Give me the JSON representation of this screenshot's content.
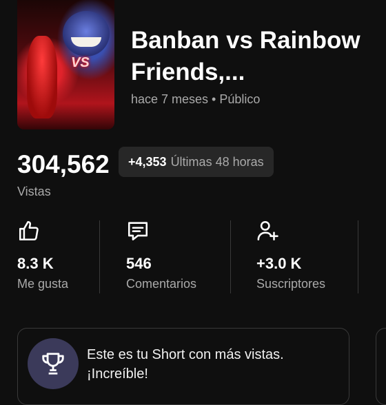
{
  "video": {
    "thumbnail": {
      "overlay_text": "VS"
    },
    "title": "Banban vs Rainbow Friends,...",
    "meta": "hace 7 meses • Público"
  },
  "views": {
    "count": "304,562",
    "label": "Vistas",
    "delta": {
      "value": "+4,353",
      "period": "Últimas 48 horas"
    }
  },
  "stats": [
    {
      "icon": "thumbs-up-icon",
      "value": "8.3 K",
      "label": "Me gusta"
    },
    {
      "icon": "comment-icon",
      "value": "546",
      "label": "Comentarios"
    },
    {
      "icon": "add-subscriber-icon",
      "value": "+3.0 K",
      "label": "Suscriptores"
    }
  ],
  "achievement": {
    "icon": "trophy-icon",
    "text": "Este es tu Short con más vistas. ¡Increíble!"
  },
  "colors": {
    "background": "#0f0f0f",
    "primary_text": "#ffffff",
    "secondary_text": "#aaaaaa",
    "chip_bg": "#272727",
    "badge_bg": "#3b3a5a"
  }
}
